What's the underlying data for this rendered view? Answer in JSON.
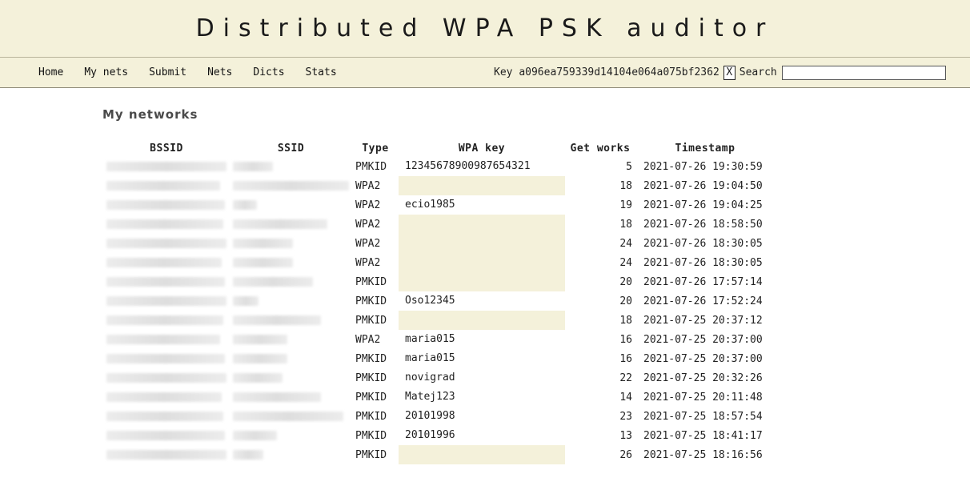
{
  "header": {
    "title": "Distributed WPA PSK auditor"
  },
  "nav": {
    "items": [
      "Home",
      "My nets",
      "Submit",
      "Nets",
      "Dicts",
      "Stats"
    ],
    "key_label": "Key",
    "key_value": "a096ea759339d14104e064a075bf2362",
    "clear_label": "X",
    "search_label": "Search",
    "search_value": ""
  },
  "page_title": "My networks",
  "table": {
    "headers": [
      "BSSID",
      "SSID",
      "Type",
      "WPA key",
      "Get works",
      "Timestamp"
    ],
    "rows": [
      {
        "type": "PMKID",
        "key": "12345678900987654321",
        "works": "5",
        "ts": "2021-07-26 19:30:59"
      },
      {
        "type": "WPA2",
        "key": "",
        "works": "18",
        "ts": "2021-07-26 19:04:50"
      },
      {
        "type": "WPA2",
        "key": "ecio1985",
        "works": "19",
        "ts": "2021-07-26 19:04:25"
      },
      {
        "type": "WPA2",
        "key": "",
        "works": "18",
        "ts": "2021-07-26 18:58:50"
      },
      {
        "type": "WPA2",
        "key": "",
        "works": "24",
        "ts": "2021-07-26 18:30:05"
      },
      {
        "type": "WPA2",
        "key": "",
        "works": "24",
        "ts": "2021-07-26 18:30:05"
      },
      {
        "type": "PMKID",
        "key": "",
        "works": "20",
        "ts": "2021-07-26 17:57:14"
      },
      {
        "type": "PMKID",
        "key": "Oso12345",
        "works": "20",
        "ts": "2021-07-26 17:52:24"
      },
      {
        "type": "PMKID",
        "key": "",
        "works": "18",
        "ts": "2021-07-25 20:37:12"
      },
      {
        "type": "WPA2",
        "key": "maria015",
        "works": "16",
        "ts": "2021-07-25 20:37:00"
      },
      {
        "type": "PMKID",
        "key": "maria015",
        "works": "16",
        "ts": "2021-07-25 20:37:00"
      },
      {
        "type": "PMKID",
        "key": "novigrad",
        "works": "22",
        "ts": "2021-07-25 20:32:26"
      },
      {
        "type": "PMKID",
        "key": "Matej123",
        "works": "14",
        "ts": "2021-07-25 20:11:48"
      },
      {
        "type": "PMKID",
        "key": "20101998",
        "works": "23",
        "ts": "2021-07-25 18:57:54"
      },
      {
        "type": "PMKID",
        "key": "20101996",
        "works": "13",
        "ts": "2021-07-25 18:41:17"
      },
      {
        "type": "PMKID",
        "key": "",
        "works": "26",
        "ts": "2021-07-25 18:16:56"
      }
    ]
  },
  "colors": {
    "header_bg": "#f4f1da",
    "empty_key_bg": "#f4f1da"
  }
}
